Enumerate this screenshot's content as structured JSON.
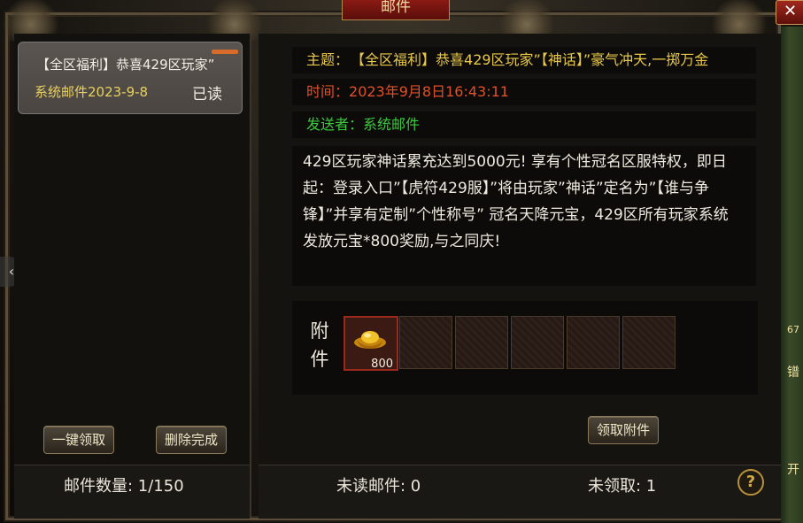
{
  "window": {
    "title": "邮件",
    "close_label": "✕"
  },
  "mail_list": {
    "items": [
      {
        "subject": "【全区福利】恭喜429区玩家”",
        "sender": "系统邮件2023-9-8",
        "status": "已读"
      }
    ],
    "claim_all_label": "一键领取",
    "delete_done_label": "删除完成",
    "count_text": "邮件数量: 1/150"
  },
  "mail_detail": {
    "subject_label": "主题：",
    "subject_value": "【全区福利】恭喜429区玩家”【神话】”豪气冲天,一掷万金",
    "time_label": "时间：",
    "time_value": "2023年9月8日16:43:11",
    "sender_label": "发送者：",
    "sender_value": "系统邮件",
    "body": "429区玩家神话累充达到5000元! 享有个性冠名区服特权，即日起：登录入口”【虎符429服】”将由玩家”神话”定名为”【谁与争锋】”并享有定制”个性称号” 冠名天降元宝，429区所有玩家系统发放元宝*800奖励,与之同庆!",
    "attachment_label": "附件",
    "attachments": [
      {
        "icon": "gold-ingot-icon",
        "quantity": "800"
      }
    ],
    "claim_label": "领取附件"
  },
  "footer": {
    "unread_text": "未读邮件: 0",
    "unclaimed_text": "未领取: 1",
    "help_label": "?"
  },
  "side_strip": {
    "text_1": "67",
    "text_2": "镨",
    "text_3": "开"
  },
  "colors": {
    "subject_label": "#e8c84a",
    "subject_value": "#e8c84a",
    "time": "#e0502a",
    "sender": "#3ec83e",
    "tab_red": "#8a1a14"
  }
}
